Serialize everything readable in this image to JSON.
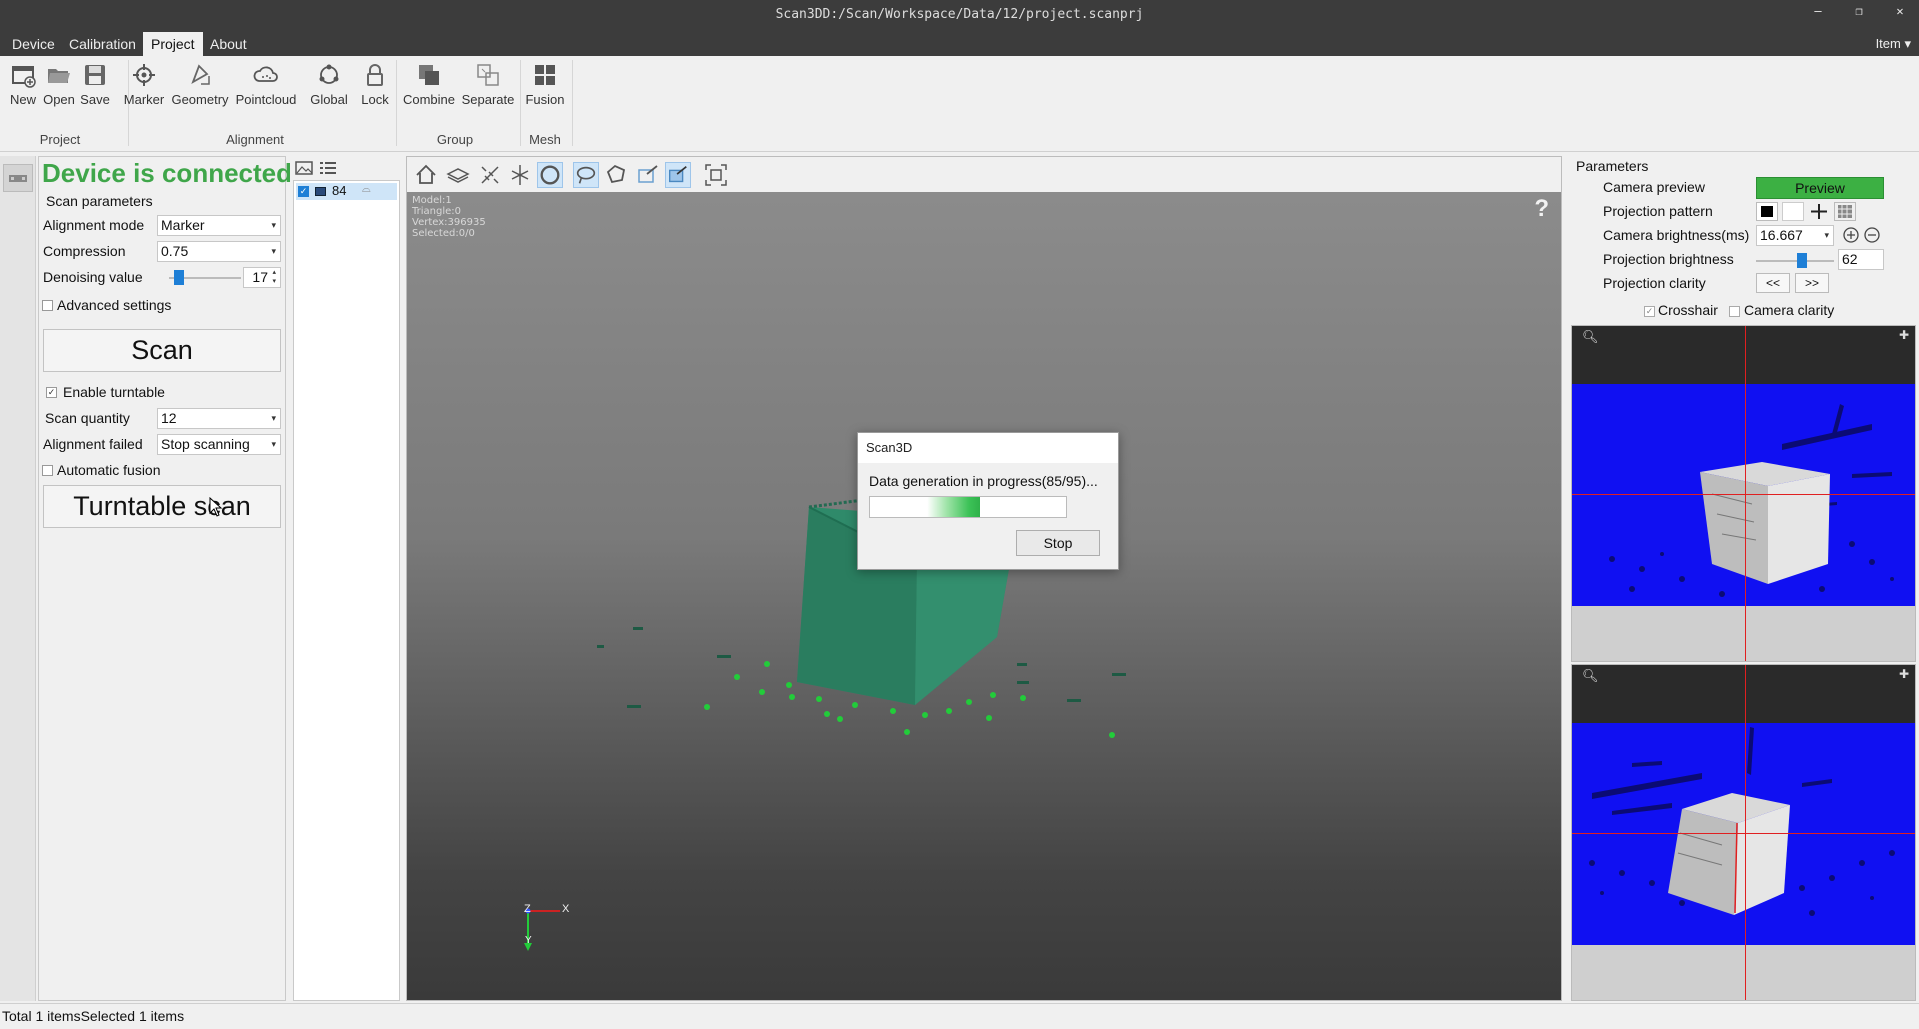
{
  "window": {
    "title": "Scan3DD:/Scan/Workspace/Data/12/project.scanprj"
  },
  "menu": {
    "items": [
      "Device",
      "Calibration",
      "Project",
      "About"
    ],
    "active": "Project",
    "right_label": "Item"
  },
  "ribbon": {
    "buttons": [
      "New",
      "Open",
      "Save",
      "Marker",
      "Geometry",
      "Pointcloud",
      "Global",
      "Lock",
      "Combine",
      "Separate",
      "Fusion"
    ],
    "groups": [
      "Project",
      "Alignment",
      "Group",
      "Mesh"
    ]
  },
  "left_panel": {
    "status": "Device is connected",
    "status_color": "#3fa64a",
    "section_title": "Scan parameters",
    "alignment_mode_label": "Alignment mode",
    "alignment_mode_value": "Marker",
    "compression_label": "Compression",
    "compression_value": "0.75",
    "denoising_label": "Denoising value",
    "denoising_value": "17",
    "advanced_label": "Advanced settings",
    "advanced_checked": false,
    "scan_button": "Scan",
    "enable_turntable_label": "Enable turntable",
    "enable_turntable_checked": true,
    "scan_quantity_label": "Scan quantity",
    "scan_quantity_value": "12",
    "alignment_failed_label": "Alignment failed",
    "alignment_failed_value": "Stop scanning",
    "automatic_fusion_label": "Automatic fusion",
    "automatic_fusion_checked": false,
    "turntable_scan_button": "Turntable scan"
  },
  "item_list": {
    "items": [
      {
        "label": "84",
        "checked": true
      }
    ]
  },
  "viewport": {
    "model_info": [
      "Model:1",
      "Triangle:0",
      "Vertex:396935",
      "Selected:0/0"
    ],
    "help": "?",
    "axis_labels": {
      "z": "Z",
      "x": "X",
      "y": "Y"
    }
  },
  "dialog": {
    "title": "Scan3D",
    "message": "Data generation in progress(85/95)...",
    "progress": 0.56,
    "stop_button": "Stop"
  },
  "right_panel": {
    "title": "Parameters",
    "camera_preview_label": "Camera preview",
    "preview_button": "Preview",
    "preview_color": "#3cb043",
    "projection_pattern_label": "Projection pattern",
    "camera_brightness_label": "Camera brightness(ms)",
    "camera_brightness_value": "16.667",
    "projection_brightness_label": "Projection brightness",
    "projection_brightness_value": "62",
    "projection_clarity_label": "Projection clarity",
    "clarity_prev": "<<",
    "clarity_next": ">>",
    "crosshair_label": "Crosshair",
    "crosshair_checked": true,
    "camera_clarity_label": "Camera clarity",
    "camera_clarity_checked": false
  },
  "status_bar": {
    "text": "Total 1 itemsSelected 1 items"
  }
}
